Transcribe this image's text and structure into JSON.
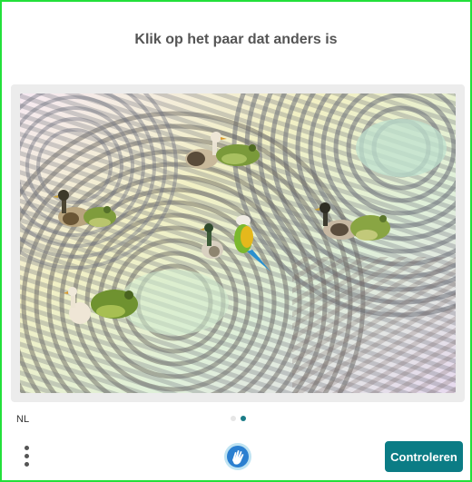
{
  "prompt": "Klik op het paar dat anders is",
  "language": "NL",
  "submit_label": "Controleren",
  "pager": {
    "total": 2,
    "active": 2
  },
  "colors": {
    "accent": "#0b7c85",
    "border": "#22e03a",
    "prompt_text": "#555555"
  },
  "animals": [
    {
      "kind": "duck"
    },
    {
      "kind": "frog"
    },
    {
      "kind": "duck"
    },
    {
      "kind": "frog"
    },
    {
      "kind": "duck"
    },
    {
      "kind": "parrot"
    },
    {
      "kind": "duck"
    },
    {
      "kind": "frog"
    },
    {
      "kind": "duck"
    },
    {
      "kind": "frog"
    }
  ],
  "icons": {
    "menu": "kebab-menu-icon",
    "logo": "hand-logo-icon"
  }
}
